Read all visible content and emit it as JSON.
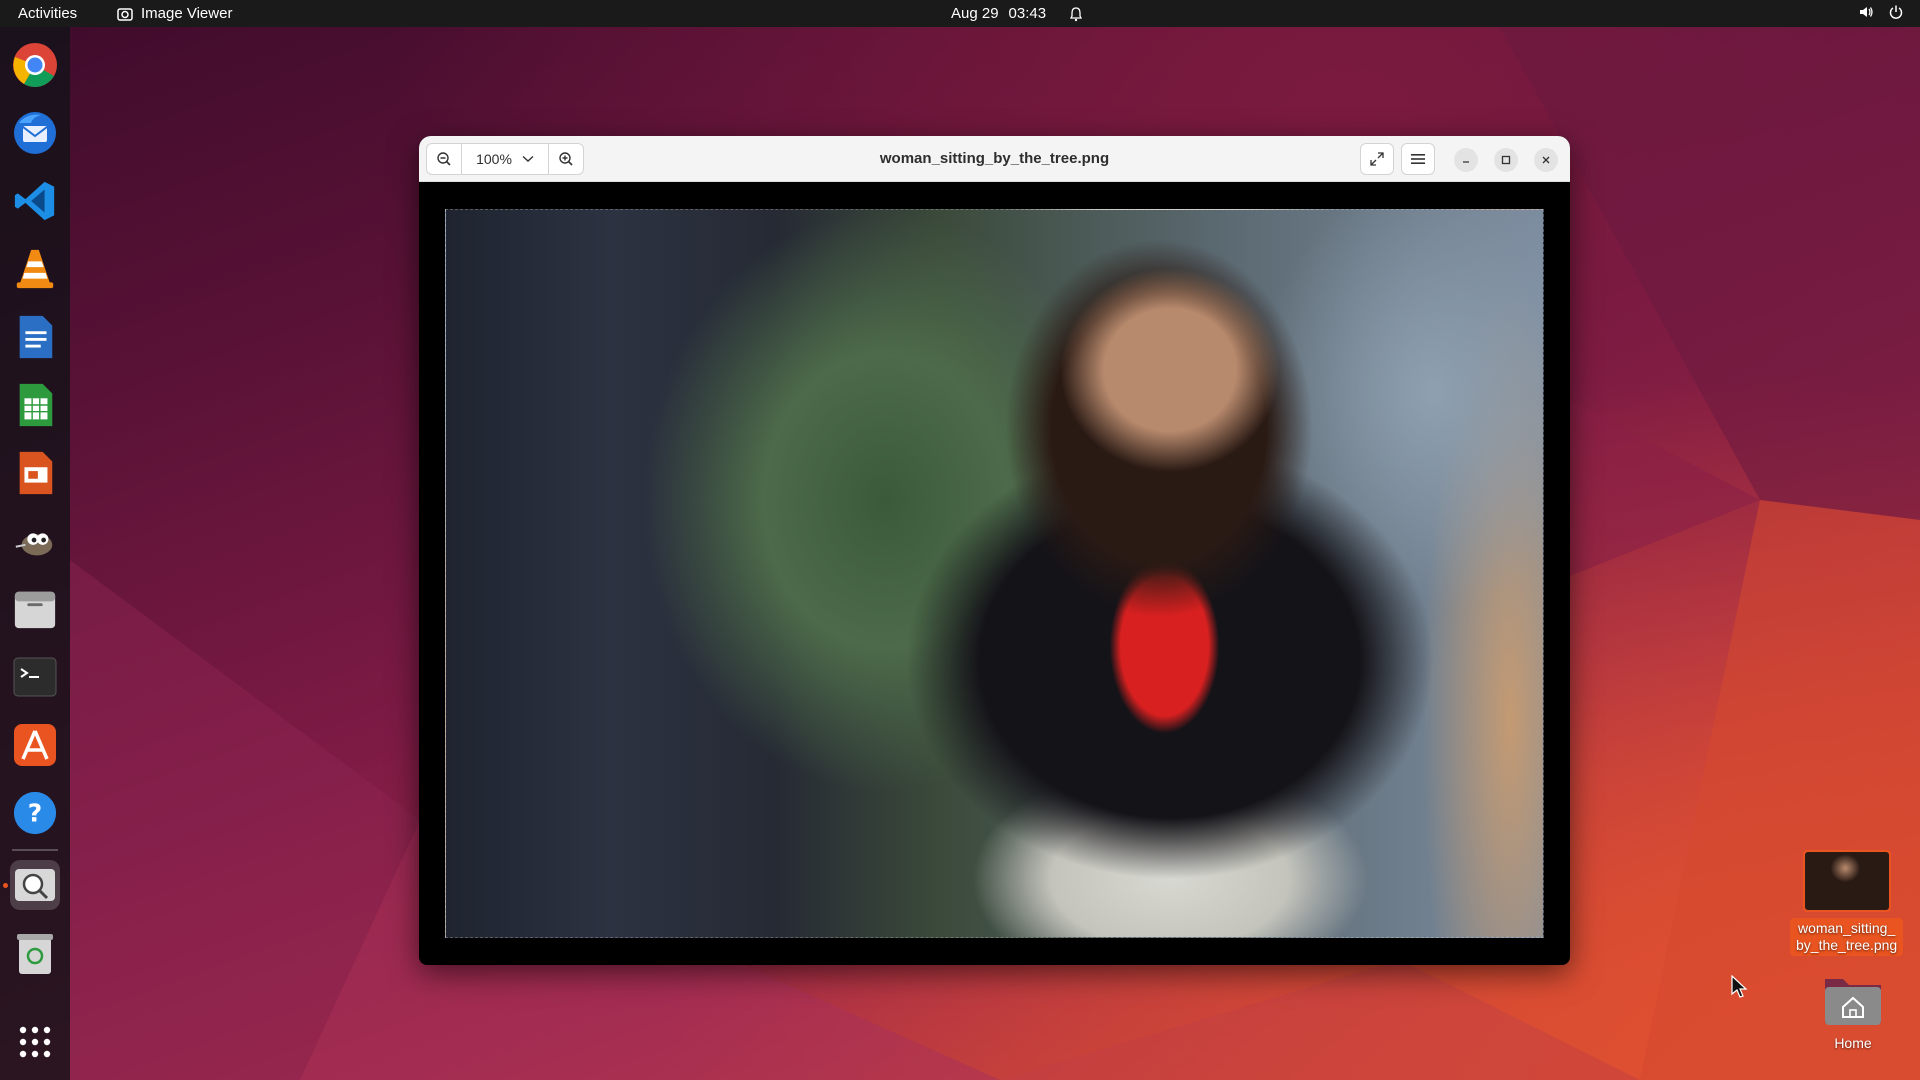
{
  "topbar": {
    "activities": "Activities",
    "app_name": "Image Viewer",
    "date": "Aug 29",
    "time": "03:43",
    "icons": [
      "notification-bell-icon",
      "volume-icon",
      "power-icon"
    ]
  },
  "dock": {
    "items": [
      {
        "name": "chrome",
        "icon": "chrome-icon"
      },
      {
        "name": "thunderbird",
        "icon": "thunderbird-icon"
      },
      {
        "name": "vscode",
        "icon": "vscode-icon"
      },
      {
        "name": "vlc",
        "icon": "vlc-icon"
      },
      {
        "name": "writer",
        "icon": "libreoffice-writer-icon"
      },
      {
        "name": "calc",
        "icon": "libreoffice-calc-icon"
      },
      {
        "name": "impress",
        "icon": "libreoffice-impress-icon"
      },
      {
        "name": "gimp",
        "icon": "gimp-icon"
      },
      {
        "name": "files",
        "icon": "files-icon"
      },
      {
        "name": "terminal",
        "icon": "terminal-icon"
      },
      {
        "name": "app-center",
        "icon": "app-center-icon"
      },
      {
        "name": "help",
        "icon": "help-icon"
      },
      {
        "name": "image-viewer",
        "icon": "image-viewer-icon",
        "active": true
      },
      {
        "name": "trash",
        "icon": "trash-icon"
      },
      {
        "name": "show-apps",
        "icon": "app-grid-icon"
      }
    ]
  },
  "window": {
    "title": "woman_sitting_by_the_tree.png",
    "zoom": "100%",
    "image_alt": "woman_sitting_by_the_tree.png"
  },
  "desktop": {
    "file_label_line1": "woman_sitting_",
    "file_label_line2": "by_the_tree.png",
    "home_label": "Home"
  },
  "colors": {
    "accent": "#e95420",
    "topbar": "#1a1a1a",
    "headerbar": "#f4f4f4"
  }
}
